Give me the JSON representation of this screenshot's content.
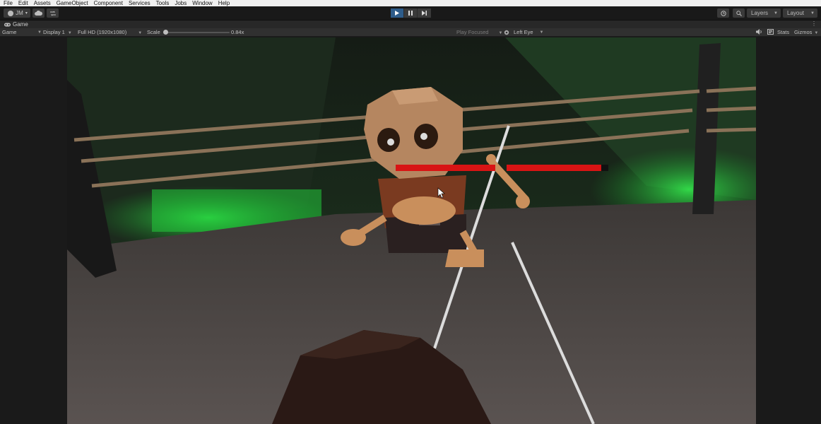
{
  "menu": [
    "File",
    "Edit",
    "Assets",
    "GameObject",
    "Component",
    "Services",
    "Tools",
    "Jobs",
    "Window",
    "Help"
  ],
  "toolbar": {
    "account_label": "JM",
    "layers_label": "Layers",
    "layout_label": "Layout"
  },
  "tab": {
    "label": "Game"
  },
  "gamebar": {
    "mode": "Game",
    "display": "Display 1",
    "resolution": "Full HD (1920x1080)",
    "scale_label": "Scale",
    "scale_value": "0.84x",
    "play_focused": "Play Focused",
    "eye": "Left Eye",
    "stats": "Stats",
    "gizmos": "Gizmos"
  },
  "game": {
    "health_left": 1.0,
    "health_right": 0.93,
    "colors": {
      "glow_green": "#22c83a",
      "health_red": "#d81414",
      "floor": "#4a4341",
      "rope": "#8a7258"
    }
  },
  "icons": [
    "account-icon",
    "cloud-icon",
    "collab-icon",
    "play-icon",
    "pause-icon",
    "step-icon",
    "history-icon",
    "search-icon",
    "game-icon",
    "audio-icon",
    "stats-icon"
  ]
}
